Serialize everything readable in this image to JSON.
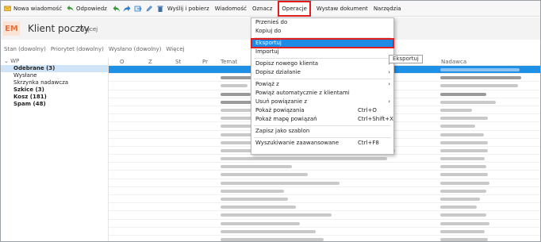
{
  "toolbar": {
    "new_message": "Nowa wiadomość",
    "reply": "Odpowiedz",
    "send_receive": "Wyślij i pobierz",
    "message_menu": "Wiadomość",
    "mark_menu": "Oznacz",
    "operations_menu": "Operacje",
    "issue_document": "Wystaw dokument",
    "tools_menu": "Narzędzia"
  },
  "header": {
    "badge": "EM",
    "title": "Klient poczty",
    "more": "Więcej"
  },
  "filters": [
    "Stan (dowolny)",
    "Priorytet (dowolny)",
    "Wysłano (dowolny)",
    "Więcej"
  ],
  "tree": {
    "root": "WP",
    "folders": [
      {
        "label": "Odebrane (3)",
        "selected": true,
        "bold": true
      },
      {
        "label": "Wysłane",
        "selected": false,
        "bold": false
      },
      {
        "label": "Skrzynka nadawcza",
        "selected": false,
        "bold": false
      },
      {
        "label": "Szkice (3)",
        "selected": false,
        "bold": true
      },
      {
        "label": "Kosz (181)",
        "selected": false,
        "bold": true
      },
      {
        "label": "Spam (48)",
        "selected": false,
        "bold": true
      }
    ]
  },
  "grid": {
    "columns": [
      "O",
      "Z",
      "St",
      "Pr",
      "Temat",
      "Nadawca"
    ]
  },
  "menu": {
    "items": [
      {
        "label": "Przenieś do",
        "shortcut": "",
        "submenu": false,
        "sep_before": false
      },
      {
        "label": "Kopiuj do",
        "shortcut": "",
        "submenu": false,
        "sep_before": false
      },
      {
        "label": "Eksportuj",
        "shortcut": "",
        "submenu": false,
        "sep_before": true,
        "highlight": true
      },
      {
        "label": "Importuj",
        "shortcut": "",
        "submenu": false,
        "sep_before": false
      },
      {
        "label": "Dopisz nowego klienta",
        "shortcut": "",
        "submenu": true,
        "sep_before": true
      },
      {
        "label": "Dopisz działanie",
        "shortcut": "",
        "submenu": true,
        "sep_before": false
      },
      {
        "label": "Powiąż z",
        "shortcut": "",
        "submenu": true,
        "sep_before": true
      },
      {
        "label": "Powiąż automatycznie z klientami",
        "shortcut": "",
        "submenu": false,
        "sep_before": false
      },
      {
        "label": "Usuń powiązanie z",
        "shortcut": "",
        "submenu": true,
        "sep_before": false
      },
      {
        "label": "Pokaż powiązania",
        "shortcut": "Ctrl+O",
        "submenu": false,
        "sep_before": false
      },
      {
        "label": "Pokaż mapę powiązań",
        "shortcut": "Ctrl+Shift+X",
        "submenu": false,
        "sep_before": false
      },
      {
        "label": "Zapisz jako szablon",
        "shortcut": "",
        "submenu": false,
        "sep_before": true
      },
      {
        "label": "Wyszukiwanie zaawansowane",
        "shortcut": "Ctrl+F8",
        "submenu": false,
        "sep_before": true
      }
    ]
  },
  "tooltip": "Eksportuj",
  "colors": {
    "accent": "#1e8be6",
    "highlight_border": "#e11d1d",
    "badge_bg": "#fbe3d4",
    "badge_fg": "#e8703a"
  },
  "icons": [
    "new-message-icon",
    "reply-icon",
    "reply-all-icon",
    "forward-icon",
    "attachment-forward-icon",
    "edit-icon",
    "delete-icon"
  ]
}
